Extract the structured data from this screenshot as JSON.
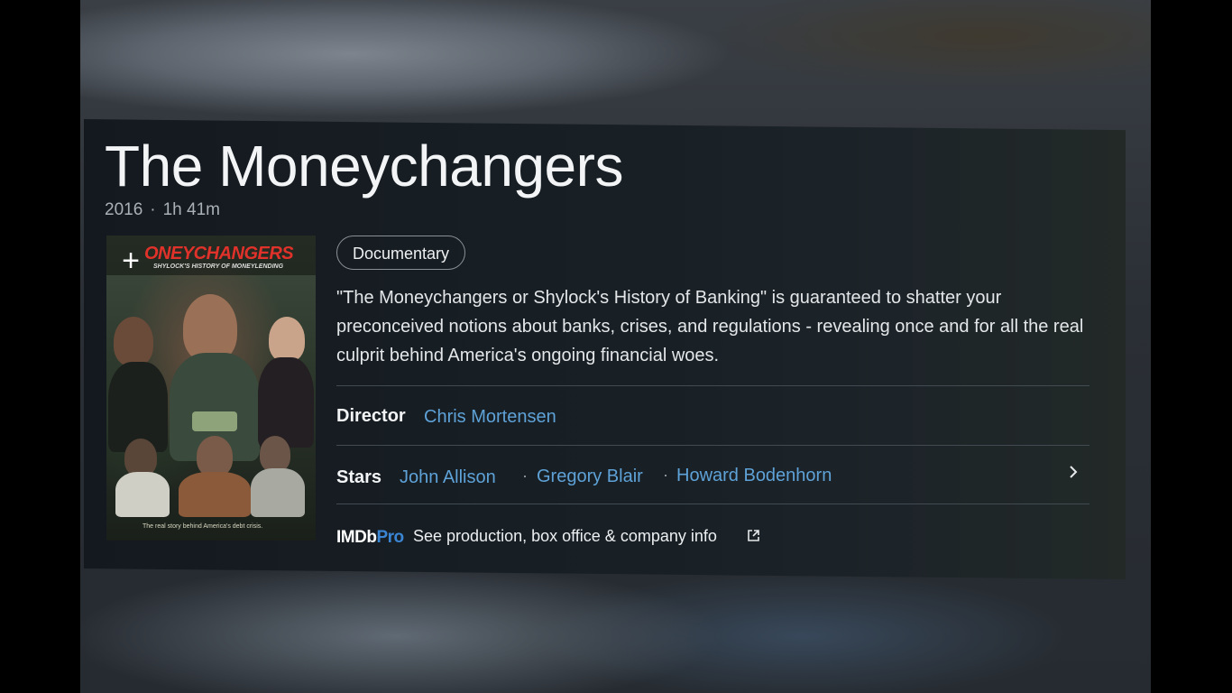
{
  "title": "The Moneychangers",
  "meta": {
    "year": "2016",
    "separator": "·",
    "runtime": "1h 41m"
  },
  "poster": {
    "title_text": "ONEYCHANGERS",
    "subtitle_text": "SHYLOCK'S HISTORY OF MONEYLENDING",
    "tagline_text": "The real story behind America's debt crisis.",
    "add_icon": "plus-icon"
  },
  "genre": "Documentary",
  "plot": "\"The Moneychangers or Shylock's History of Banking\" is guaranteed to shatter your preconceived notions about banks, crises, and regulations - revealing once and for all the real culprit behind America's ongoing financial woes.",
  "director": {
    "label": "Director",
    "name": "Chris Mortensen"
  },
  "stars": {
    "label": "Stars",
    "names": [
      "John Allison",
      "Gregory Blair",
      "Howard Bodenhorn"
    ],
    "separator": "·",
    "more_icon": "chevron-right-icon"
  },
  "imdbpro": {
    "logo_left": "IMDb",
    "logo_right": "Pro",
    "text": "See production, box office & company info",
    "link_icon": "external-link-icon"
  },
  "colors": {
    "link": "#5ea2d8",
    "pro_blue": "#3b86d4",
    "panel": "#182026"
  }
}
